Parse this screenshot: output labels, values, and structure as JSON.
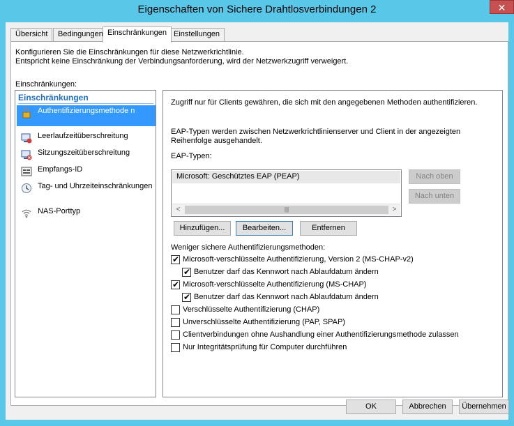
{
  "window": {
    "title": "Eigenschaften von Sichere Drahtlosverbindungen 2",
    "close_glyph": "✕"
  },
  "tabs": [
    {
      "label": "Übersicht"
    },
    {
      "label": "Bedingungen"
    },
    {
      "label": "Einschränkungen"
    },
    {
      "label": "Einstellungen"
    }
  ],
  "intro": {
    "line1": "Konfigurieren Sie die Einschränkungen für diese Netzwerkrichtlinie.",
    "line2": "Entspricht keine Einschränkung der Verbindungsanforderung, wird der Netzwerkzugriff verweigert."
  },
  "restrictions_label": "Einschränkungen:",
  "nav": {
    "header": "Einschränkungen",
    "items": [
      {
        "label": "Authentifizierungsmethode n",
        "icon": "lock-icon",
        "selected": true
      },
      {
        "label": "Leerlaufzeitüberschreitung",
        "icon": "idle-timeout-icon",
        "selected": false
      },
      {
        "label": "Sitzungszeitüberschreitung",
        "icon": "session-timeout-icon",
        "selected": false
      },
      {
        "label": "Empfangs-ID",
        "icon": "id-icon",
        "selected": false
      },
      {
        "label": "Tag- und Uhrzeiteinschränkungen",
        "icon": "clock-icon",
        "selected": false
      },
      {
        "label": "NAS-Porttyp",
        "icon": "wireless-icon",
        "selected": false
      }
    ]
  },
  "details": {
    "desc": "Zugriff nur für Clients gewähren, die sich mit den angegebenen Methoden authentifizieren.",
    "eap_desc": "EAP-Typen werden zwischen Netzwerkrichtlinienserver und Client in der angezeigten Reihenfolge ausgehandelt.",
    "eap_label": "EAP-Typen:",
    "eap_items": [
      "Microsoft: Geschütztes EAP (PEAP)"
    ],
    "move_up": "Nach oben",
    "move_down": "Nach unten",
    "add": "Hinzufügen...",
    "edit": "Bearbeiten...",
    "remove": "Entfernen",
    "less_secure_label": "Weniger sichere Authentifizierungsmethoden:",
    "checkboxes": [
      {
        "label": "Microsoft-verschlüsselte Authentifizierung, Version 2 (MS-CHAP-v2)",
        "checked": true,
        "indent": false
      },
      {
        "label": "Benutzer darf das Kennwort nach Ablaufdatum ändern",
        "checked": true,
        "indent": true
      },
      {
        "label": "Microsoft-verschlüsselte Authentifizierung (MS-CHAP)",
        "checked": true,
        "indent": false
      },
      {
        "label": "Benutzer darf das Kennwort nach Ablaufdatum ändern",
        "checked": true,
        "indent": true
      },
      {
        "label": "Verschlüsselte Authentifizierung (CHAP)",
        "checked": false,
        "indent": false
      },
      {
        "label": "Unverschlüsselte Authentifizierung (PAP, SPAP)",
        "checked": false,
        "indent": false
      },
      {
        "label": "Clientverbindungen ohne Aushandlung einer Authentifizierungsmethode zulassen",
        "checked": false,
        "indent": false
      },
      {
        "label": "Nur Integritätsprüfung für Computer durchführen",
        "checked": false,
        "indent": false
      }
    ]
  },
  "footer": {
    "ok": "OK",
    "cancel": "Abbrechen",
    "apply": "Übernehmen"
  },
  "colors": {
    "titlebar": "#58c7e8",
    "selection": "#3399ff",
    "header_blue": "#1e6ec8"
  }
}
